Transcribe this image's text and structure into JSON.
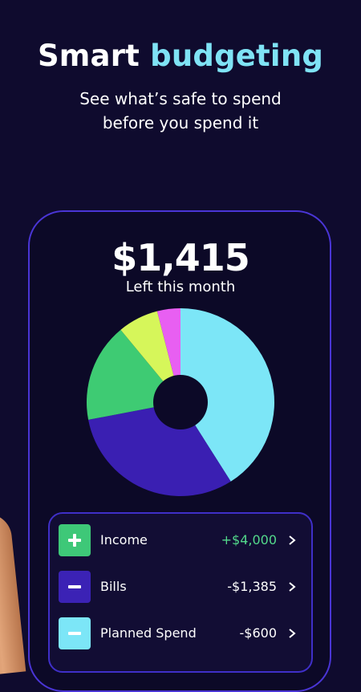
{
  "header": {
    "title_part1": "Smart",
    "title_part2": "budgeting",
    "subtitle_line1": "See what’s safe to spend",
    "subtitle_line2": "before you spend it"
  },
  "summary": {
    "amount": "$1,415",
    "label": "Left this month"
  },
  "chart_data": {
    "type": "pie",
    "values": [
      41,
      31,
      17,
      7,
      4
    ],
    "colors": [
      "#7ce6f7",
      "#3a1fb2",
      "#3ecb73",
      "#d6f65a",
      "#e85ff2"
    ]
  },
  "rows": [
    {
      "label": "Income",
      "value": "+$4,000",
      "icon": "plus-icon",
      "badge_color": "#3ec878",
      "value_color": "#53d98b"
    },
    {
      "label": "Bills",
      "value": "-$1,385",
      "icon": "minus-icon",
      "badge_color": "#3b22b5",
      "value_color": "#ffffff"
    },
    {
      "label": "Planned Spend",
      "value": "-$600",
      "icon": "minus-icon",
      "badge_color": "#7ce6f7",
      "value_color": "#ffffff"
    }
  ]
}
